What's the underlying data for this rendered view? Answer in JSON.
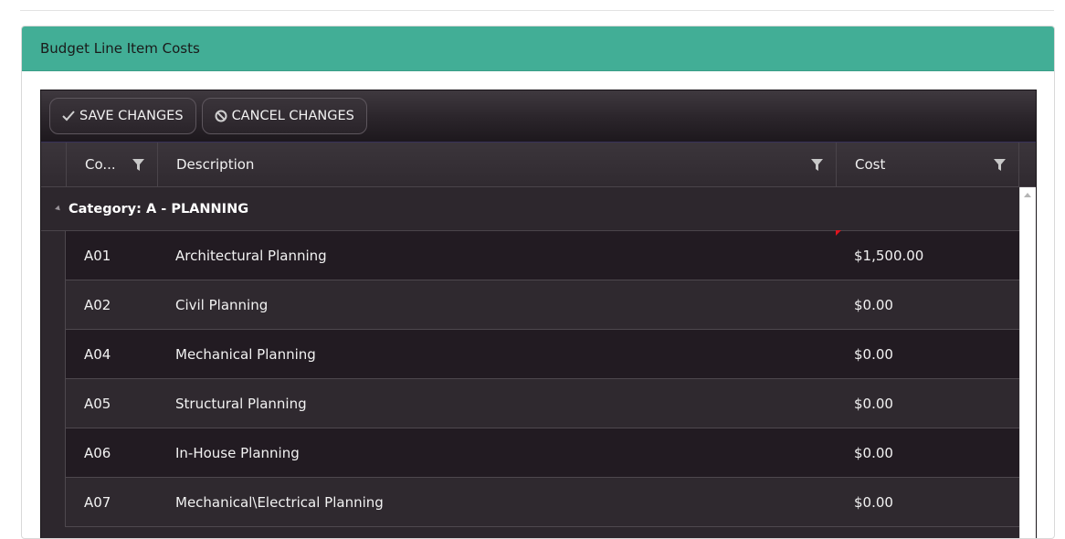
{
  "panel": {
    "title": "Budget Line Item Costs"
  },
  "toolbar": {
    "save_label": "SAVE CHANGES",
    "cancel_label": "CANCEL CHANGES"
  },
  "columns": {
    "code": "Co...",
    "description": "Description",
    "cost": "Cost"
  },
  "group": {
    "label": "Category: A - PLANNING"
  },
  "rows": [
    {
      "code": "A01",
      "description": "Architectural Planning",
      "cost": "$1,500.00"
    },
    {
      "code": "A02",
      "description": "Civil Planning",
      "cost": "$0.00"
    },
    {
      "code": "A04",
      "description": "Mechanical Planning",
      "cost": "$0.00"
    },
    {
      "code": "A05",
      "description": "Structural Planning",
      "cost": "$0.00"
    },
    {
      "code": "A06",
      "description": "In-House Planning",
      "cost": "$0.00"
    },
    {
      "code": "A07",
      "description": "Mechanical\\Electrical Planning",
      "cost": "$0.00"
    }
  ],
  "colors": {
    "header_accent": "#42ae96",
    "grid_bg": "#2d272d",
    "dirty_marker": "#e0141e"
  }
}
